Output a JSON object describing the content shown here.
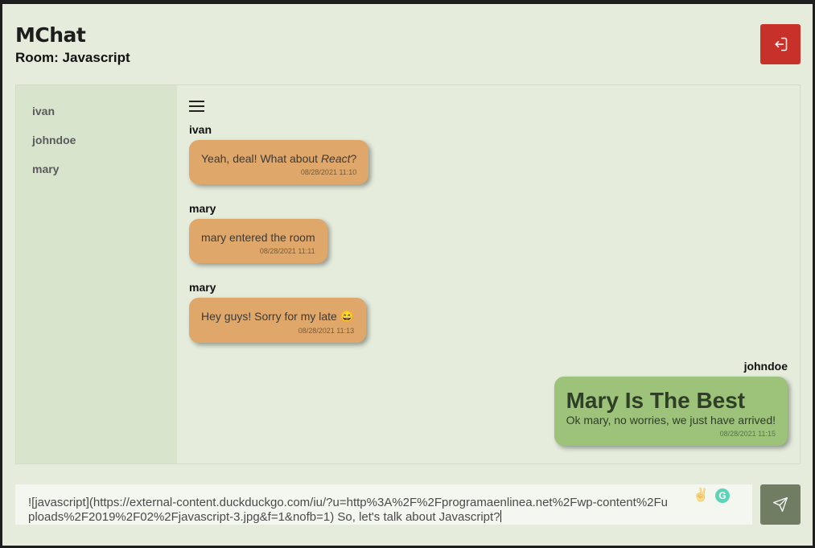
{
  "app": {
    "logo_text": "MChat",
    "room_label": "Room: Javascript"
  },
  "sidebar": {
    "users": [
      {
        "name": "ivan"
      },
      {
        "name": "johndoe"
      },
      {
        "name": "mary"
      }
    ]
  },
  "messages": [
    {
      "sender": "ivan",
      "text_before": "Yeah, deal! What about ",
      "text_emph": "React",
      "text_after": "?",
      "time": "08/28/2021 11:10"
    },
    {
      "sender": "mary",
      "text": "mary entered the room",
      "time": "08/28/2021 11:11"
    },
    {
      "sender": "mary",
      "text": "Hey guys! Sorry for my late 😄",
      "time": "08/28/2021 11:13"
    },
    {
      "sender": "johndoe",
      "heading": "Mary Is The Best",
      "text": "Ok mary, no worries, we just have arrived!",
      "time": "08/28/2021 11:15"
    }
  ],
  "composer": {
    "value": "![javascript](https://external-content.duckduckgo.com/iu/?u=http%3A%2F%2Fprogramaenlinea.net%2Fwp-content%2Fuploads%2F2019%2F02%2Fjavascript-3.jpg&f=1&nofb=1) So, let's talk about Javascript?",
    "ext_icon_1": "✌",
    "ext_icon_2": "G"
  },
  "colors": {
    "background": "#e5ecdc",
    "sidebar": "#d8e4cc",
    "bubble_other": "#dfa76a",
    "bubble_self": "#9dc27a",
    "logout": "#c8302a",
    "send": "#707d63",
    "logo_accent": "#e8a33a"
  },
  "icons": {
    "logout": "logout-icon",
    "menu": "menu-icon",
    "send": "send-icon"
  }
}
